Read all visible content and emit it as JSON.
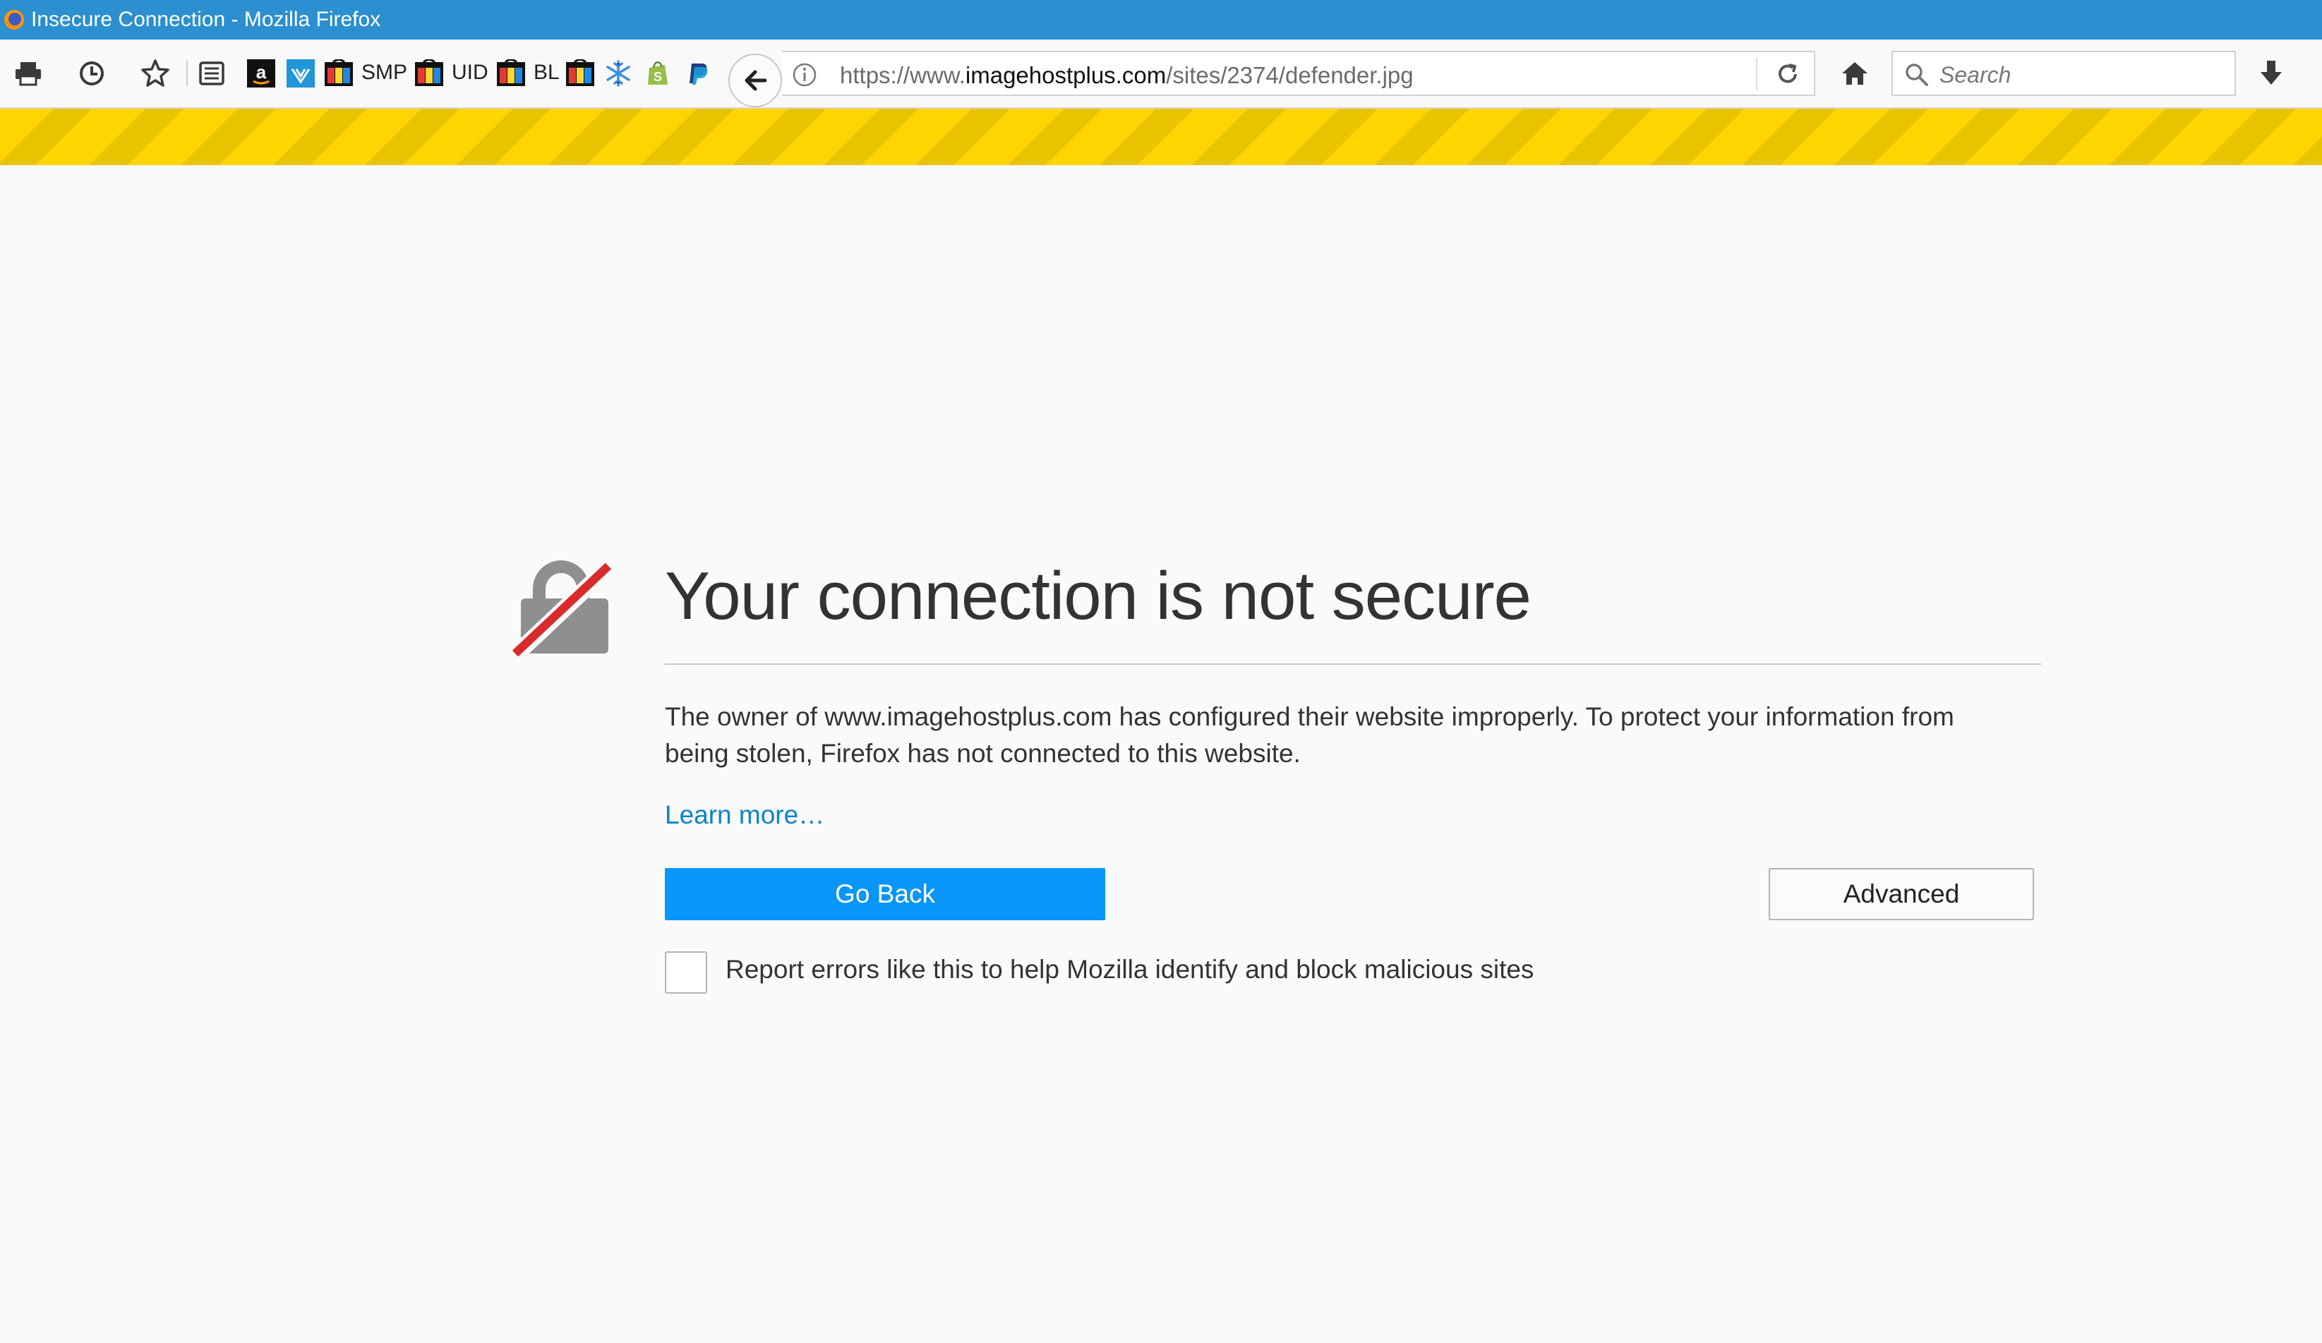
{
  "window": {
    "title": "Insecure Connection - Mozilla Firefox"
  },
  "toolbar": {
    "bookmarks": [
      {
        "icon": "amazon-icon"
      },
      {
        "icon": "vine-icon"
      },
      {
        "icon": "tricolor-icon",
        "label": "SMP"
      },
      {
        "icon": "tricolor-icon",
        "label": "UID"
      },
      {
        "icon": "tricolor-icon",
        "label": "BL"
      },
      {
        "icon": "tricolor-icon"
      },
      {
        "icon": "snowflake-icon"
      },
      {
        "icon": "shopify-icon"
      },
      {
        "icon": "paypal-icon"
      }
    ],
    "url": {
      "prefix": "https://www.",
      "domain": "imagehostplus.com",
      "path": "/sites/2374/defender.jpg"
    },
    "search_placeholder": "Search"
  },
  "error": {
    "title": "Your connection is not secure",
    "description": "The owner of www.imagehostplus.com has configured their website improperly. To protect your information from being stolen, Firefox has not connected to this website.",
    "learn_more": "Learn more…",
    "go_back": "Go Back",
    "advanced": "Advanced",
    "report_label": "Report errors like this to help Mozilla identify and block malicious sites",
    "report_checked": false
  },
  "colors": {
    "titlebar": "#2b8fd0",
    "primary_button": "#0996f8",
    "link": "#0a84c8",
    "warning_stripe": "#ffd500",
    "lock_slash": "#d92b2b"
  }
}
